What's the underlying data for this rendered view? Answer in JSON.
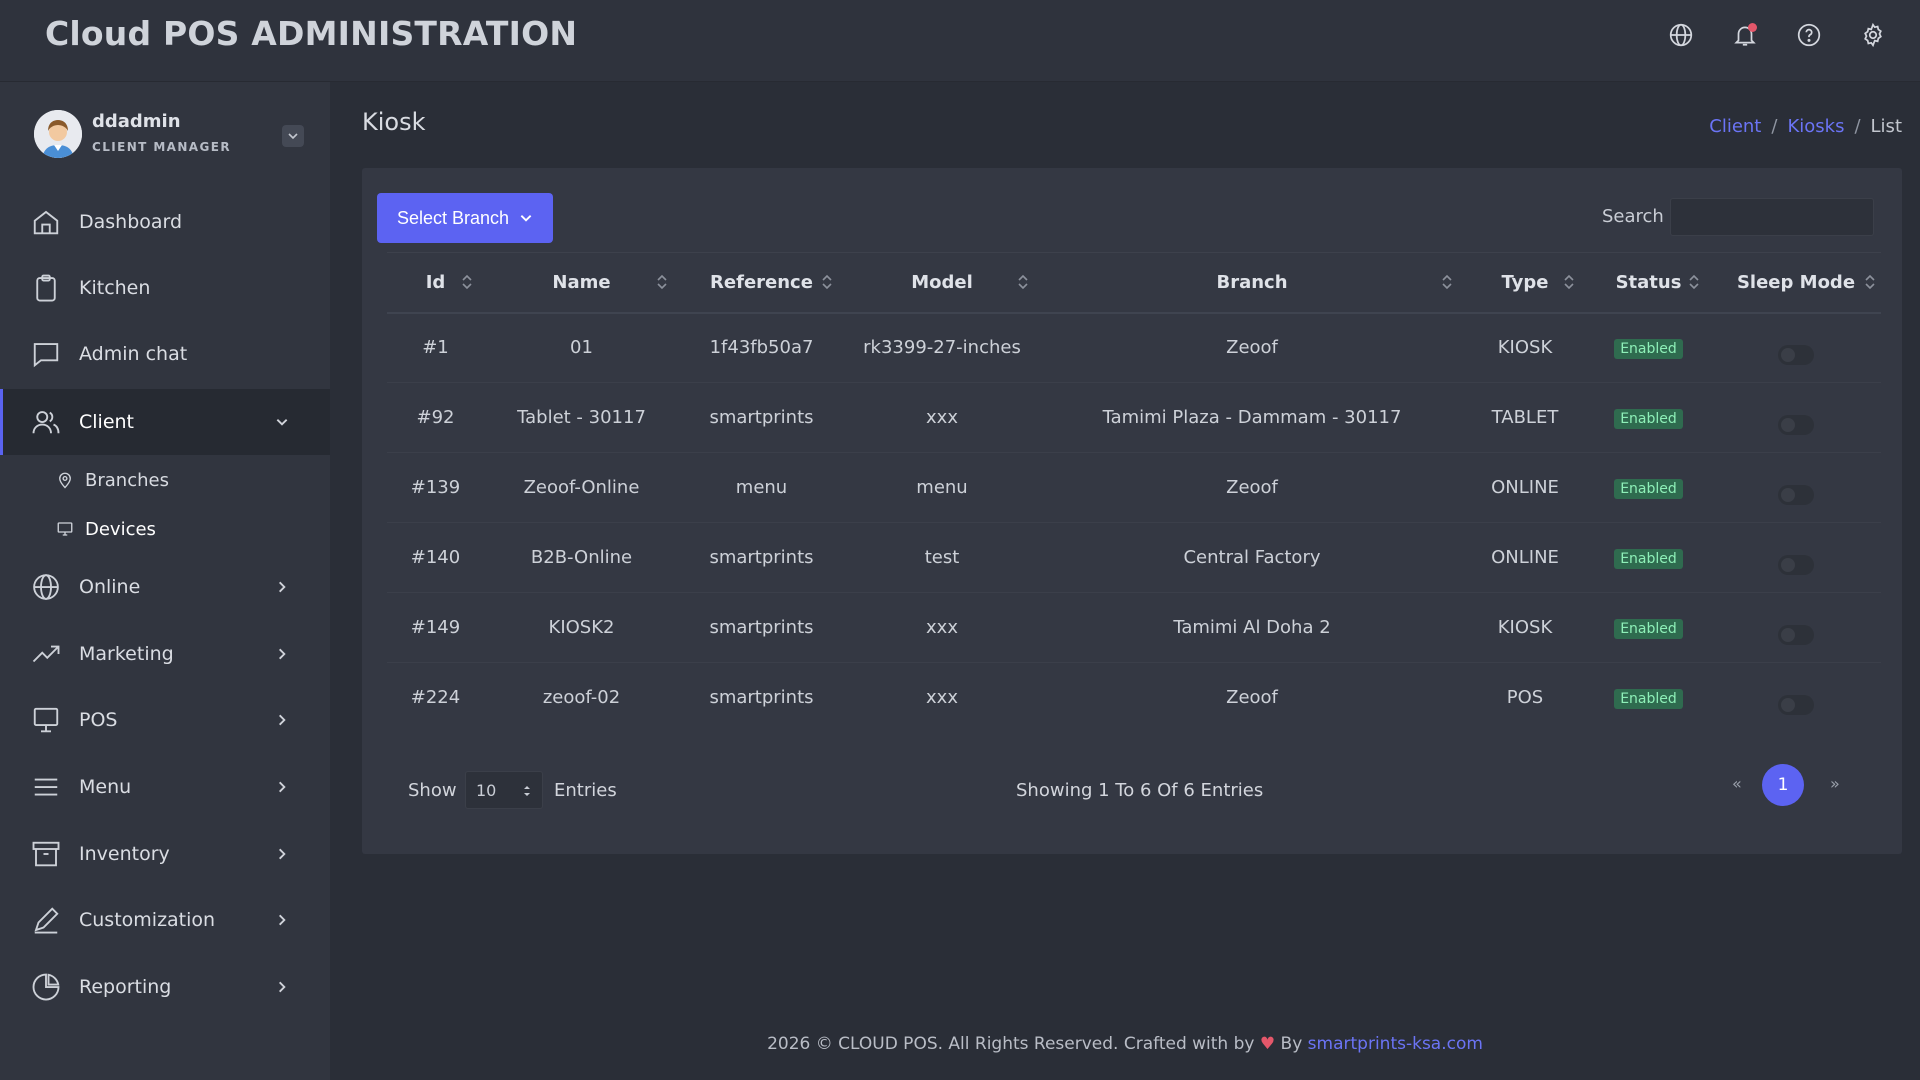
{
  "header": {
    "title": "Cloud POS ADMINISTRATION"
  },
  "user": {
    "name": "ddadmin",
    "role": "CLIENT MANAGER"
  },
  "sidebar": {
    "items": [
      {
        "label": "Dashboard"
      },
      {
        "label": "Kitchen"
      },
      {
        "label": "Admin chat"
      },
      {
        "label": "Client"
      },
      {
        "label": "Online"
      },
      {
        "label": "Marketing"
      },
      {
        "label": "POS"
      },
      {
        "label": "Menu"
      },
      {
        "label": "Inventory"
      },
      {
        "label": "Customization"
      },
      {
        "label": "Reporting"
      }
    ],
    "sub_items": [
      {
        "label": "Branches"
      },
      {
        "label": "Devices"
      }
    ]
  },
  "page": {
    "title": "Kiosk",
    "breadcrumb": [
      "Client",
      "Kiosks",
      "List"
    ]
  },
  "toolbar": {
    "select_branch": "Select Branch",
    "search_label": "Search",
    "search_value": ""
  },
  "table": {
    "columns": [
      "Id",
      "Name",
      "Reference",
      "Model",
      "Branch",
      "Type",
      "Status",
      "Sleep Mode"
    ],
    "rows": [
      {
        "id": "#1",
        "name": "01",
        "reference": "1f43fb50a7",
        "model": "rk3399-27-inches",
        "branch": "Zeoof",
        "type": "KIOSK",
        "status": "Enabled"
      },
      {
        "id": "#92",
        "name": "Tablet - 30117",
        "reference": "smartprints",
        "model": "xxx",
        "branch": "Tamimi Plaza - Dammam - 30117",
        "type": "TABLET",
        "status": "Enabled"
      },
      {
        "id": "#139",
        "name": "Zeoof-Online",
        "reference": "menu",
        "model": "menu",
        "branch": "Zeoof",
        "type": "ONLINE",
        "status": "Enabled"
      },
      {
        "id": "#140",
        "name": "B2B-Online",
        "reference": "smartprints",
        "model": "test",
        "branch": "Central Factory",
        "type": "ONLINE",
        "status": "Enabled"
      },
      {
        "id": "#149",
        "name": "KIOSK2",
        "reference": "smartprints",
        "model": "xxx",
        "branch": "Tamimi Al Doha 2",
        "type": "KIOSK",
        "status": "Enabled"
      },
      {
        "id": "#224",
        "name": "zeoof-02",
        "reference": "smartprints",
        "model": "xxx",
        "branch": "Zeoof",
        "type": "POS",
        "status": "Enabled"
      }
    ]
  },
  "pagination": {
    "show_label": "Show",
    "page_size": "10",
    "entries_label": "Entries",
    "summary": "Showing 1 To 6 Of 6 Entries",
    "prev": "«",
    "current": "1",
    "next": "»"
  },
  "footer": {
    "text": "2026 © CLOUD POS. All Rights Reserved. Crafted with by",
    "heart": "♥",
    "by": "By",
    "link": "smartprints-ksa.com"
  },
  "colors": {
    "accent": "#5c63f2",
    "badge_bg": "#2f6b4f",
    "badge_text": "#8ef0b8",
    "notification": "#e4576a"
  }
}
